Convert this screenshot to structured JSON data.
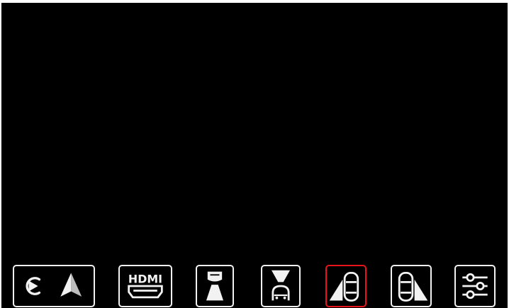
{
  "toolbar": {
    "buttons": [
      {
        "id": "carplay-androidauto",
        "label": "",
        "icon": "carplay-androidauto-icon"
      },
      {
        "id": "hdmi",
        "label": "HDMI",
        "icon": "hdmi-icon"
      },
      {
        "id": "front-camera",
        "label": "",
        "icon": "front-camera-view-icon"
      },
      {
        "id": "rear-camera",
        "label": "",
        "icon": "rear-camera-view-icon"
      },
      {
        "id": "left-camera",
        "label": "",
        "icon": "left-camera-view-icon",
        "active": true
      },
      {
        "id": "right-camera",
        "label": "",
        "icon": "right-camera-view-icon"
      },
      {
        "id": "settings",
        "label": "",
        "icon": "settings-sliders-icon"
      }
    ]
  },
  "colors": {
    "background": "#000000",
    "icon": "#f2f2f2",
    "active_border": "#e8141b"
  }
}
